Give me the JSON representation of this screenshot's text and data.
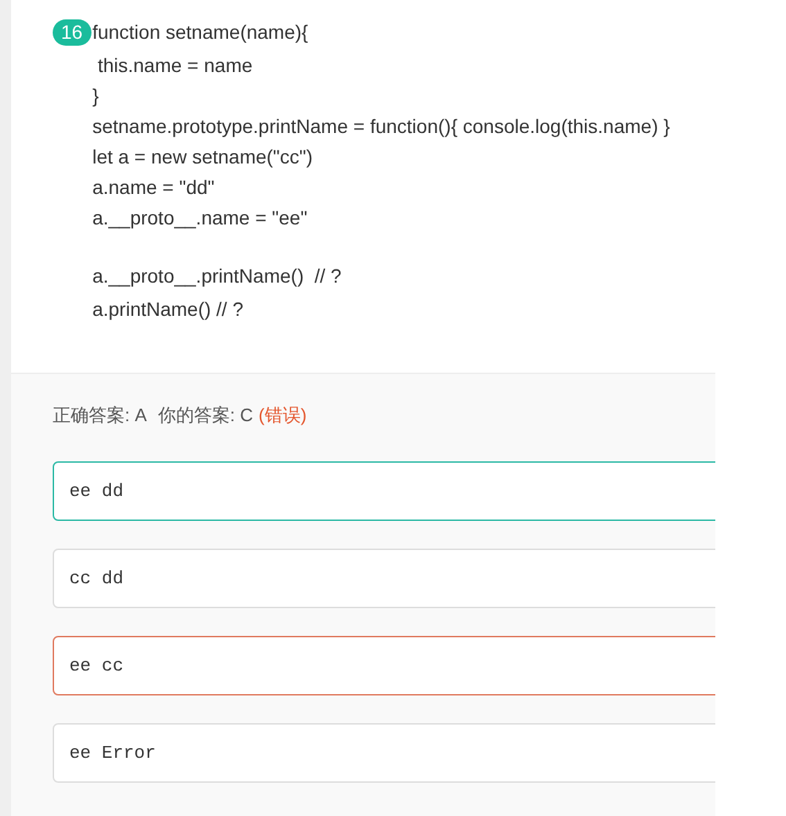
{
  "question": {
    "number": "16",
    "code_blocks": [
      [
        "function setname(name){",
        " this.name = name",
        "}",
        "setname.prototype.printName = function(){ console.log(this.name) }",
        "let a = new setname(\"cc\")",
        "a.name = \"dd\"",
        "a.__proto__.name = \"ee\""
      ],
      [
        "a.__proto__.printName()  // ?",
        "a.printName() // ?"
      ]
    ]
  },
  "result": {
    "correct_answer": "正确答案: A",
    "your_answer": "你的答案: C",
    "verdict": "(错误)"
  },
  "options": [
    {
      "text": "ee dd",
      "kind": "correct"
    },
    {
      "text": "cc dd",
      "kind": "plain"
    },
    {
      "text": "ee cc",
      "kind": "wrong"
    },
    {
      "text": "ee Error",
      "kind": "plain"
    }
  ]
}
